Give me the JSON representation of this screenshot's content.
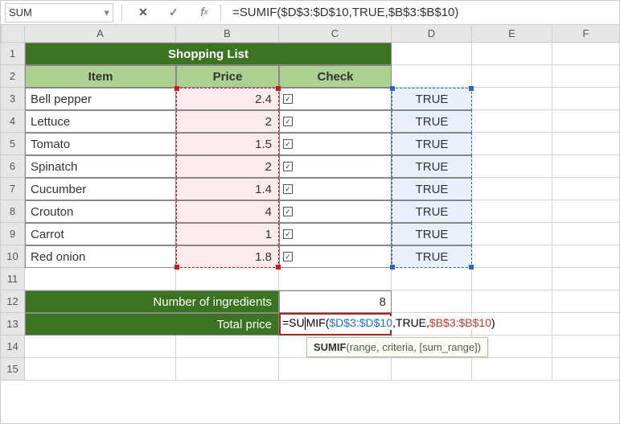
{
  "formula_bar": {
    "name_box": "SUM",
    "formula": "=SUMIF($D$3:$D$10,TRUE,$B$3:$B$10)"
  },
  "columns": [
    "A",
    "B",
    "C",
    "D",
    "E",
    "F"
  ],
  "rows": [
    "1",
    "2",
    "3",
    "4",
    "5",
    "6",
    "7",
    "8",
    "9",
    "10",
    "11",
    "12",
    "13",
    "14",
    "15"
  ],
  "title": "Shopping List",
  "headers": {
    "item": "Item",
    "price": "Price",
    "check": "Check"
  },
  "items": [
    {
      "name": "Bell pepper",
      "price": "2.4",
      "check": true,
      "d": "TRUE"
    },
    {
      "name": "Lettuce",
      "price": "2",
      "check": true,
      "d": "TRUE"
    },
    {
      "name": "Tomato",
      "price": "1.5",
      "check": true,
      "d": "TRUE"
    },
    {
      "name": "Spinatch",
      "price": "2",
      "check": true,
      "d": "TRUE"
    },
    {
      "name": "Cucumber",
      "price": "1.4",
      "check": true,
      "d": "TRUE"
    },
    {
      "name": "Crouton",
      "price": "4",
      "check": true,
      "d": "TRUE"
    },
    {
      "name": "Carrot",
      "price": "1",
      "check": true,
      "d": "TRUE"
    },
    {
      "name": "Red onion",
      "price": "1.8",
      "check": true,
      "d": "TRUE"
    }
  ],
  "summary": {
    "num_ingredients_label": "Number of ingredients",
    "num_ingredients_value": "8",
    "total_price_label": "Total price"
  },
  "active_formula_parts": {
    "p1": "=SU",
    "p2": "MIF(",
    "p3": "$D$3:$D$10",
    "p4": ",TRUE,",
    "p5": "$B$3:$B$10",
    "p6": ")"
  },
  "tooltip": {
    "fn": "SUMIF",
    "args": "(range, criteria, [sum_range])"
  },
  "checkmark": "✓",
  "chart_data": {
    "type": "table",
    "title": "Shopping List",
    "columns": [
      "Item",
      "Price",
      "Check",
      "D"
    ],
    "rows": [
      [
        "Bell pepper",
        2.4,
        true,
        "TRUE"
      ],
      [
        "Lettuce",
        2,
        true,
        "TRUE"
      ],
      [
        "Tomato",
        1.5,
        true,
        "TRUE"
      ],
      [
        "Spinatch",
        2,
        true,
        "TRUE"
      ],
      [
        "Cucumber",
        1.4,
        true,
        "TRUE"
      ],
      [
        "Crouton",
        4,
        true,
        "TRUE"
      ],
      [
        "Carrot",
        1,
        true,
        "TRUE"
      ],
      [
        "Red onion",
        1.8,
        true,
        "TRUE"
      ]
    ],
    "summary": {
      "Number of ingredients": 8,
      "Total price formula": "=SUMIF($D$3:$D$10,TRUE,$B$3:$B$10)"
    }
  }
}
